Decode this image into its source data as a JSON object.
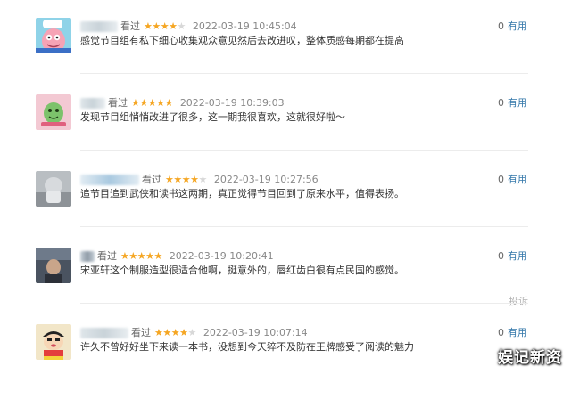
{
  "reviews": [
    {
      "action": "看过",
      "rating": 4,
      "time": "2022-03-19 10:45:04",
      "comment": "感觉节目组有私下细心收集观众意见然后去改进叹，整体质感每期都在提高",
      "useful_count": "0",
      "useful_label": "有用",
      "avatar": "patrick-chef-cartoon"
    },
    {
      "action": "看过",
      "rating": 5,
      "time": "2022-03-19 10:39:03",
      "comment": "发现节目组悄悄改进了很多，这一期我很喜欢，这就很好啦～",
      "useful_count": "0",
      "useful_label": "有用",
      "avatar": "green-cartoon-pink-background"
    },
    {
      "action": "看过",
      "rating": 4,
      "time": "2022-03-19 10:27:56",
      "comment": "追节目追到武侠和读书这两期，真正觉得节目回到了原来水平，值得表扬。",
      "useful_count": "0",
      "useful_label": "有用",
      "avatar": "grey-photo"
    },
    {
      "action": "看过",
      "rating": 5,
      "time": "2022-03-19 10:20:41",
      "comment": "宋亚轩这个制服造型很适合他啊，挺意外的，唇红齿白很有点民国的感觉。",
      "useful_count": "0",
      "useful_label": "有用",
      "report_label": "投诉",
      "avatar": "dark-photo"
    },
    {
      "action": "看过",
      "rating": 4,
      "time": "2022-03-19 10:07:14",
      "comment": "许久不曾好好坐下来读一本书，没想到今天猝不及防在王牌感受了阅读的魅力",
      "useful_count": "0",
      "useful_label": "有用",
      "avatar": "crayon-shin-chan"
    }
  ],
  "watermark": "娱记新资",
  "colors": {
    "star": "#f5a623",
    "star_off": "#d8d8d8",
    "link": "#3377aa",
    "time": "#888888"
  }
}
